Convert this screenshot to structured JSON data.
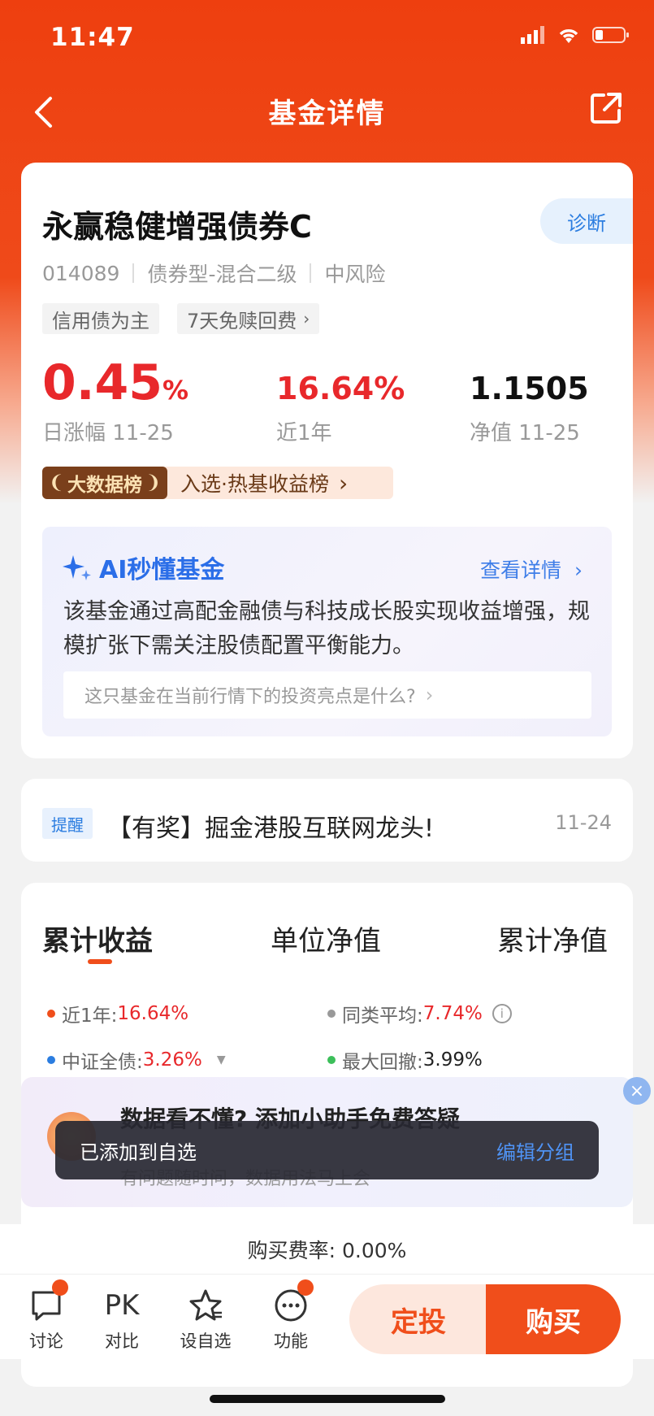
{
  "status_bar": {
    "time": "11:47"
  },
  "nav": {
    "title": "基金详情"
  },
  "fund": {
    "name": "永赢稳健增强债券C",
    "diagnose_label": "诊断",
    "code": "014089",
    "type": "债券型-混合二级",
    "risk": "中风险",
    "tags": [
      "信用债为主",
      "7天免赎回费"
    ],
    "daily_change": {
      "value": "0.45",
      "unit": "%",
      "label": "日涨幅 11-25"
    },
    "year_return": {
      "value": "16.64%",
      "label": "近1年"
    },
    "nav_value": {
      "value": "1.1505",
      "label": "净值 11-25"
    },
    "rank": {
      "badge": "大数据榜",
      "text": "入选·热基收益榜"
    }
  },
  "ai": {
    "title": "AI秒懂基金",
    "more": "查看详情",
    "summary": "该基金通过高配金融债与科技成长股实现收益增强，规模扩张下需关注股债配置平衡能力。",
    "question": "这只基金在当前行情下的投资亮点是什么?"
  },
  "reminder": {
    "tag": "提醒",
    "text": "【有奖】掘金港股互联网龙头!",
    "date": "11-24"
  },
  "performance": {
    "tabs": [
      "累计收益",
      "单位净值",
      "累计净值"
    ],
    "legend": [
      {
        "label": "近1年:",
        "value": "16.64%",
        "color": "#f04e1b"
      },
      {
        "label": "同类平均:",
        "value": "7.74%",
        "color": "#999999"
      },
      {
        "label": "中证全债:",
        "value": "3.26%",
        "color": "#2b7de0"
      },
      {
        "label": "最大回撤:",
        "value": "3.99%",
        "color": "#3cbf5a"
      }
    ]
  },
  "banner": {
    "text": "数据看不懂? 添加小助手免费答疑",
    "sub": "有问题随时问，数据用法马上会"
  },
  "toast": {
    "message": "已添加到自选",
    "action": "编辑分组"
  },
  "fee": {
    "text": "购买费率: 0.00%"
  },
  "bottom_bar": {
    "items": [
      {
        "label": "讨论",
        "icon": "chat-icon"
      },
      {
        "label": "对比",
        "icon_text": "PK"
      },
      {
        "label": "设自选",
        "icon": "star-icon"
      },
      {
        "label": "功能",
        "icon": "more-icon"
      }
    ],
    "invest_label": "定投",
    "buy_label": "购买"
  }
}
